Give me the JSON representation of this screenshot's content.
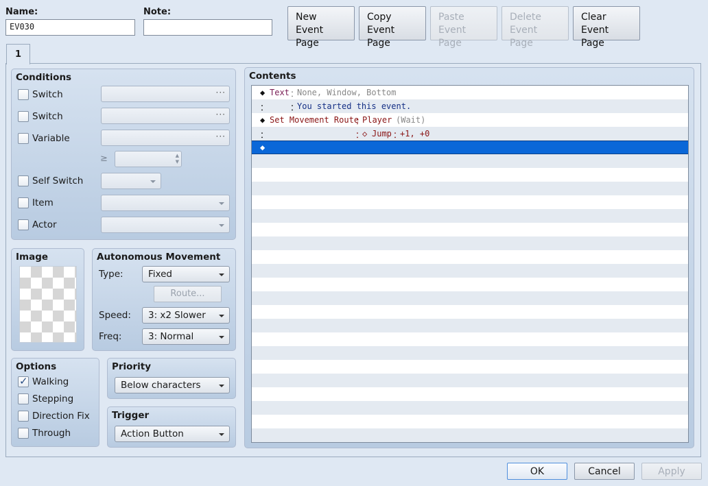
{
  "header": {
    "name_label": "Name:",
    "name_value": "EV030",
    "note_label": "Note:",
    "note_value": "",
    "buttons": [
      {
        "line1": "New",
        "line2": "Event Page",
        "enabled": true
      },
      {
        "line1": "Copy",
        "line2": "Event Page",
        "enabled": true
      },
      {
        "line1": "Paste",
        "line2": "Event Page",
        "enabled": false
      },
      {
        "line1": "Delete",
        "line2": "Event Page",
        "enabled": false
      },
      {
        "line1": "Clear",
        "line2": "Event Page",
        "enabled": true
      }
    ]
  },
  "tabs": [
    {
      "label": "1",
      "active": true
    }
  ],
  "conditions": {
    "title": "Conditions",
    "switch1_label": "Switch",
    "switch2_label": "Switch",
    "variable_label": "Variable",
    "geq_symbol": "≥",
    "self_switch_label": "Self Switch",
    "item_label": "Item",
    "actor_label": "Actor",
    "ellipsis": "···",
    "checked": {
      "switch1": false,
      "switch2": false,
      "variable": false,
      "self_switch": false,
      "item": false,
      "actor": false
    }
  },
  "image": {
    "title": "Image"
  },
  "autonomous": {
    "title": "Autonomous Movement",
    "type_label": "Type:",
    "type_value": "Fixed",
    "route_button": "Route...",
    "speed_label": "Speed:",
    "speed_value": "3: x2 Slower",
    "freq_label": "Freq:",
    "freq_value": "3: Normal"
  },
  "options": {
    "title": "Options",
    "walking": "Walking",
    "stepping": "Stepping",
    "direction_fix": "Direction Fix",
    "through": "Through",
    "checked": {
      "walking": true,
      "stepping": false,
      "direction_fix": false,
      "through": false
    },
    "check_glyph": "✓"
  },
  "priority": {
    "title": "Priority",
    "value": "Below characters"
  },
  "trigger": {
    "title": "Trigger",
    "value": "Action Button"
  },
  "contents": {
    "title": "Contents",
    "rows": [
      {
        "marker": "◆",
        "cmd": "Text",
        "sep": "：",
        "args": "None, Window, Bottom"
      },
      {
        "marker": "：",
        "text_sep": "：",
        "text": "You started this event."
      },
      {
        "marker": "◆",
        "cmd": "Set Movement Route",
        "sep": "：",
        "target": "Player",
        "extra": "(Wait)"
      },
      {
        "marker": "：",
        "sub_sep": "：",
        "sub_marker": "◇",
        "sub_cmd": "Jump",
        "sub_sep2": "：",
        "sub_args": "+1, +0"
      },
      {
        "marker": "◆",
        "selected": true
      }
    ]
  },
  "footer": {
    "ok": "OK",
    "cancel": "Cancel",
    "apply": "Apply"
  },
  "colors": {
    "selection": "#0a67d8",
    "panel": "#c6d6e9",
    "background": "#dfe8f3"
  }
}
